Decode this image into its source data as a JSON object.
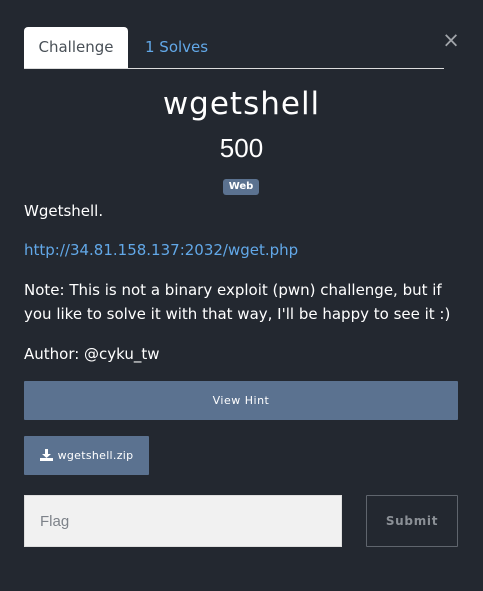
{
  "modal": {
    "close_symbol": "×",
    "tabs": [
      {
        "label": "Challenge",
        "active": true
      },
      {
        "label": "1 Solves",
        "active": false
      }
    ],
    "title": "wgetshell",
    "points": "500",
    "category": "Web",
    "description": {
      "line1": "Wgetshell.",
      "url": "http://34.81.158.137:2032/wget.php",
      "note": "Note: This is not a binary exploit (pwn) challenge, but if you like to solve it with that way, I'll be happy to see it :)",
      "author": "Author: @cyku_tw"
    },
    "hint_button": "View Hint",
    "file_button": "wgetshell.zip",
    "flag_placeholder": "Flag",
    "submit_button": "Submit"
  },
  "colors": {
    "background": "#232830",
    "accent": "#5b7290",
    "link": "#62a8e8",
    "icon": "download-icon"
  }
}
